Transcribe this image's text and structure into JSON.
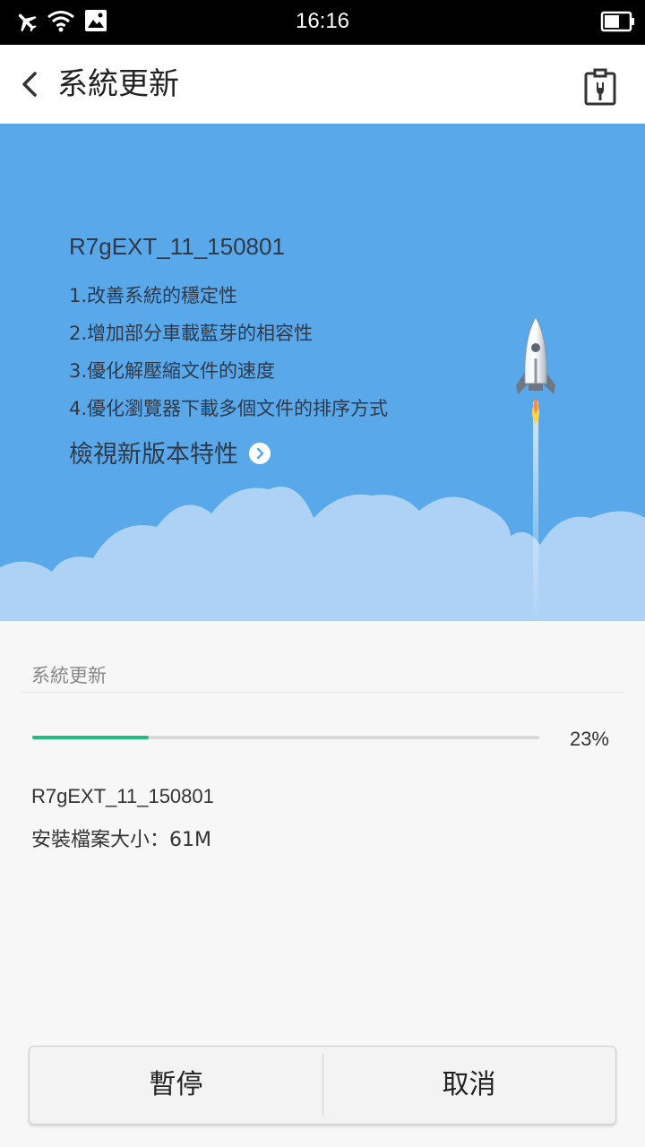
{
  "status_bar": {
    "time": "16:16",
    "icons": [
      "airplane-mode-icon",
      "wifi-icon",
      "image-notification-icon",
      "battery-icon"
    ]
  },
  "app_bar": {
    "back_icon": "chevron-left-icon",
    "title": "系統更新",
    "tool_icon": "clipboard-wrench-icon"
  },
  "hero": {
    "version": "R7gEXT_11_150801",
    "notes": [
      "1.改善系統的穩定性",
      "2.增加部分車載藍芽的相容性",
      "3.優化解壓縮文件的速度",
      "4.優化瀏覽器下載多個文件的排序方式"
    ],
    "view_features_label": "檢視新版本特性",
    "background_color": "#59a8ea",
    "cloud_color": "#aed2f6"
  },
  "download": {
    "section_title": "系統更新",
    "progress_percent": 23,
    "progress_label": "23%",
    "progress_color": "#1fc07f",
    "package_version": "R7gEXT_11_150801",
    "file_size_label": "安裝檔案大小：61M"
  },
  "buttons": {
    "pause_label": "暫停",
    "cancel_label": "取消"
  }
}
